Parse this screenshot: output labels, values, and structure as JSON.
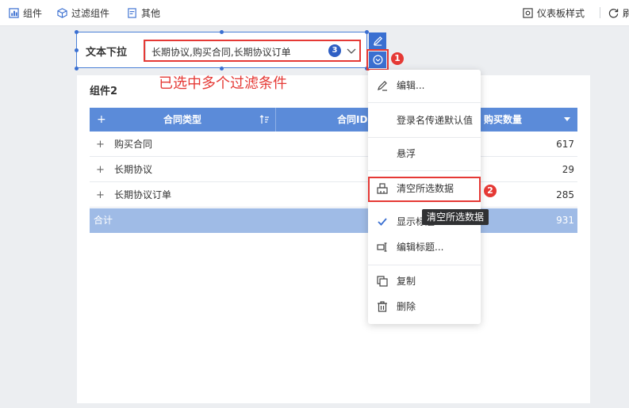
{
  "toolbar": {
    "component_label": "组件",
    "filter_component_label": "过滤组件",
    "other_label": "其他",
    "dashboard_style_label": "仪表板样式",
    "refresh_label": "刷"
  },
  "filter": {
    "label": "文本下拉",
    "selected_values": "长期协议,购买合同,长期协议订单",
    "selected_count": "3"
  },
  "annotations": {
    "marker_1": "1",
    "marker_2": "2",
    "note": "已选中多个过滤条件"
  },
  "widget": {
    "title": "组件2",
    "columns": [
      "合同类型",
      "合同ID",
      "购买数量"
    ],
    "rows": [
      {
        "name": "购买合同",
        "value": "617"
      },
      {
        "name": "长期协议",
        "value": "29"
      },
      {
        "name": "长期协议订单",
        "value": "285"
      }
    ],
    "total": {
      "name": "合计",
      "value": "931"
    }
  },
  "menu": {
    "items": [
      {
        "label": "编辑...",
        "icon": "edit-icon"
      },
      {
        "label": "登录名传递默认值",
        "icon": ""
      },
      {
        "label": "悬浮",
        "icon": ""
      },
      {
        "label": "清空所选数据",
        "icon": "clear-icon"
      },
      {
        "label": "显示标题",
        "icon": "check-icon"
      },
      {
        "label": "编辑标题...",
        "icon": "edit-title-icon"
      },
      {
        "label": "复制",
        "icon": "copy-icon"
      },
      {
        "label": "删除",
        "icon": "trash-icon"
      }
    ]
  },
  "tooltip": {
    "text": "清空所选数据"
  },
  "colors": {
    "accent": "#3a6fd1",
    "table_header": "#5b8bd9",
    "total_row": "#9fbbe6",
    "annotation": "#e53935"
  }
}
